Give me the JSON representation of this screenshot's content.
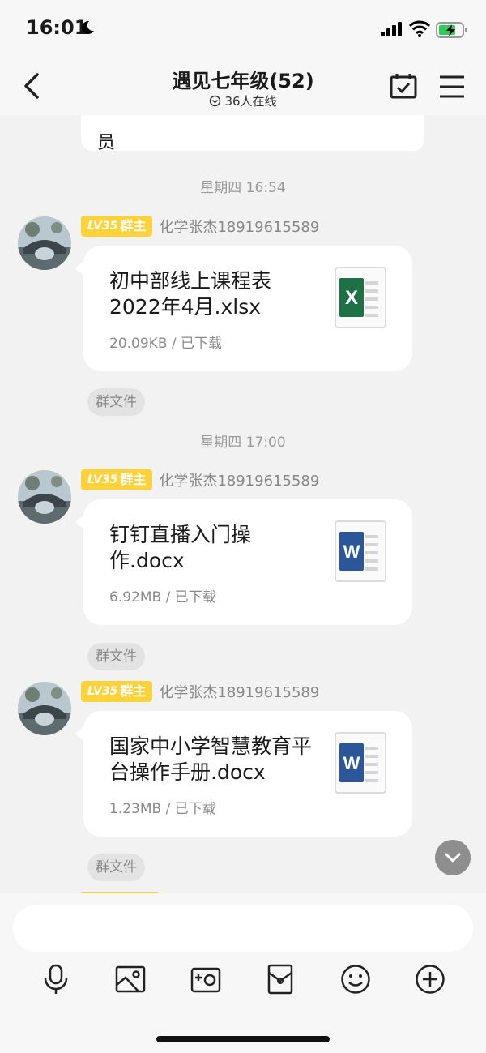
{
  "status_bar": {
    "time": "16:01"
  },
  "header": {
    "title": "遇见七年级(52)",
    "online": "36人在线"
  },
  "chat": {
    "prev_message_tail": "员",
    "messages": [
      {
        "timestamp": "星期四 16:54",
        "badge_level": "LV35",
        "badge_role": "群主",
        "sender": "化学张杰18919615589",
        "file_name": "初中部线上课程表2022年4月.xlsx",
        "file_meta": "20.09KB / 已下载",
        "file_type": "excel",
        "tag": "群文件"
      },
      {
        "timestamp": "星期四 17:00",
        "badge_level": "LV35",
        "badge_role": "群主",
        "sender": "化学张杰18919615589",
        "file_name": "钉钉直播入门操作.docx",
        "file_meta": "6.92MB / 已下载",
        "file_type": "word",
        "tag": "群文件"
      },
      {
        "timestamp": "",
        "badge_level": "LV35",
        "badge_role": "群主",
        "sender": "化学张杰18919615589",
        "file_name": "国家中小学智慧教育平台操作手册.docx",
        "file_meta": "1.23MB / 已下载",
        "file_type": "word",
        "tag": "群文件"
      }
    ]
  },
  "icons": {
    "back": "chevron-left-icon",
    "calendar": "calendar-check-icon",
    "menu": "hamburger-menu-icon",
    "excel": "excel-file-icon",
    "word": "word-file-icon",
    "scroll_down": "chevron-down-icon",
    "toolbar": [
      "microphone-icon",
      "image-icon",
      "camera-icon",
      "red-packet-icon",
      "emoji-icon",
      "plus-circle-icon"
    ]
  },
  "colors": {
    "badge": "#ffd23a",
    "excel": "#1e7145",
    "word": "#2b579a",
    "background": "#f2f2f2"
  }
}
